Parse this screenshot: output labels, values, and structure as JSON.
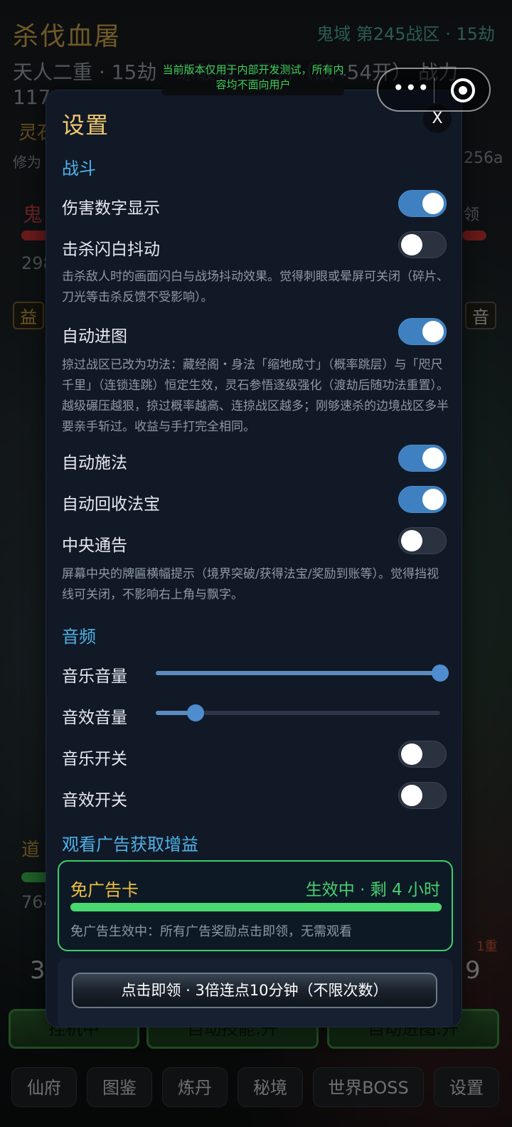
{
  "background": {
    "title": "杀伐血屠",
    "zone": "鬼域 第245战区 · 15劫",
    "realm_line": "天人二重 · 15劫 · 练破境 · 灵力（战454开） 战力",
    "power_line": "117",
    "spirit_label": "灵石",
    "cultivation_label": "修为",
    "hash_fragment": "256a",
    "enemy_label": "鬼",
    "claim_label": "领",
    "hp_value": "298",
    "buff_label": "益",
    "audio_label": "音",
    "dao_label": "道",
    "dao_value": "764",
    "layer_badge": "1重",
    "left_num": "3",
    "right_num": "9",
    "dev_notice": "当前版本仅用于内部开发测试，所有内容均不面向用户"
  },
  "actions": {
    "idle": "挂机中",
    "auto_skill": "自动技能:开",
    "auto_advance": "自动进图:开"
  },
  "nav": {
    "items": [
      "仙府",
      "图鉴",
      "炼丹",
      "秘境",
      "世界BOSS",
      "设置"
    ]
  },
  "settings": {
    "title": "设置",
    "close": "X",
    "battle_section": "战斗",
    "damage_numbers": {
      "label": "伤害数字显示",
      "on": true
    },
    "kill_flash": {
      "label": "击杀闪白抖动",
      "on": false,
      "desc": "击杀敌人时的画面闪白与战场抖动效果。觉得刺眼或晕屏可关闭（碎片、刀光等击杀反馈不受影响）。"
    },
    "auto_advance": {
      "label": "自动进图",
      "on": true,
      "desc": "掠过战区已改为功法：藏经阁・身法「缩地成寸」（概率跳层）与「咫尺千里」（连锁连跳）恒定生效，灵石参悟逐级强化（渡劫后随功法重置）。越级碾压越狠，掠过概率越高、连掠战区越多；刚够速杀的边境战区多半要亲手斩过。收益与手打完全相同。"
    },
    "auto_cast": {
      "label": "自动施法",
      "on": true
    },
    "auto_recycle": {
      "label": "自动回收法宝",
      "on": true
    },
    "central_notice": {
      "label": "中央通告",
      "on": false,
      "desc": "屏幕中央的牌匾横幅提示（境界突破/获得法宝/奖励到账等）。觉得挡视线可关闭，不影响右上角与飘字。"
    },
    "audio_section": "音频",
    "music_volume": {
      "label": "音乐音量",
      "value": 1.0
    },
    "sfx_volume": {
      "label": "音效音量",
      "value": 0.14
    },
    "music_switch": {
      "label": "音乐开关",
      "on": false
    },
    "sfx_switch": {
      "label": "音效开关",
      "on": false
    },
    "ad_section": "观看广告获取增益",
    "ad_free_card": {
      "title": "免广告卡",
      "status": "生效中 · 剩 4 小时",
      "progress": 1.0,
      "desc": "免广告生效中：所有广告奖励点击即领，无需观看"
    },
    "claim_button": "点击即领 · 3倍连点10分钟（不限次数）"
  },
  "colors": {
    "accent_gold": "#f0c870",
    "section_blue": "#4fb3e8",
    "toggle_on": "#3f80c0",
    "active_green": "#4ad070"
  }
}
